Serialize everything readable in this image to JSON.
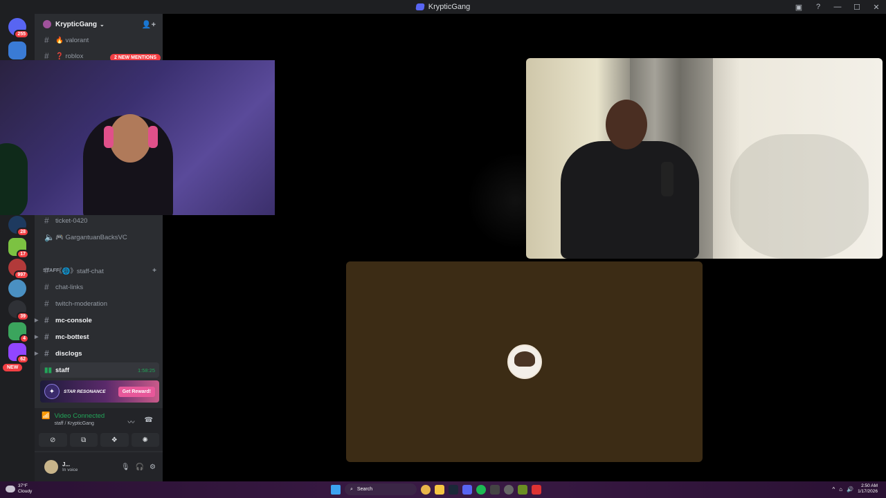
{
  "window": {
    "title": "KrypticGang",
    "controls": [
      "inbox-icon",
      "help-icon",
      "minimize-icon",
      "maximize-icon",
      "close-icon"
    ]
  },
  "server_rail": {
    "servers": [
      {
        "name": "direct-messages",
        "color": "#5865f2",
        "badge": "255"
      },
      {
        "name": "server-1",
        "color": "#3a7bd5",
        "badge": ""
      },
      {
        "name": "server-2",
        "color": "#1e3a5f",
        "badge": "28"
      },
      {
        "name": "server-3",
        "color": "#7cc242",
        "badge": "17"
      },
      {
        "name": "server-4",
        "color": "#b23a3a",
        "badge": "997"
      },
      {
        "name": "server-5",
        "color": "#4a90c2",
        "badge": ""
      },
      {
        "name": "server-6",
        "color": "#2f3136",
        "badge": "39"
      },
      {
        "name": "server-7",
        "color": "#3ba55d",
        "badge": "4"
      },
      {
        "name": "server-8",
        "color": "#9146ff",
        "badge": "62"
      }
    ],
    "new_label": "NEW"
  },
  "server": {
    "name": "KrypticGang",
    "mention_pill": "2 NEW MENTIONS"
  },
  "channels": {
    "top": [
      {
        "label": "🔥 valorant"
      },
      {
        "label": "❓ roblox"
      }
    ],
    "mid": [
      {
        "label": "ticket-0420",
        "type": "text"
      },
      {
        "label": "🎮 GargantuanBacksVC",
        "type": "voice"
      }
    ],
    "category": "STAFF",
    "staff": [
      {
        "label": "《🌐》staff-chat",
        "bold": false
      },
      {
        "label": "chat-links",
        "bold": false
      },
      {
        "label": "twitch-moderation",
        "bold": false
      },
      {
        "label": "mc-console",
        "bold": true
      },
      {
        "label": "mc-bottest",
        "bold": true
      },
      {
        "label": "disclogs",
        "bold": true
      }
    ],
    "active_voice": {
      "label": "staff",
      "timer": "1:58:25"
    }
  },
  "promo": {
    "game": "STAR RESONANCE",
    "button": "Get Reward!"
  },
  "voice_status": {
    "status": "Video Connected",
    "location": "staff / KrypticGang"
  },
  "user": {
    "name": "J...",
    "status": "In voice"
  },
  "taskbar": {
    "temp": "37°F",
    "weather": "Cloudy",
    "search_placeholder": "Search",
    "time": "2:50 AM",
    "date": "1/17/2026"
  }
}
